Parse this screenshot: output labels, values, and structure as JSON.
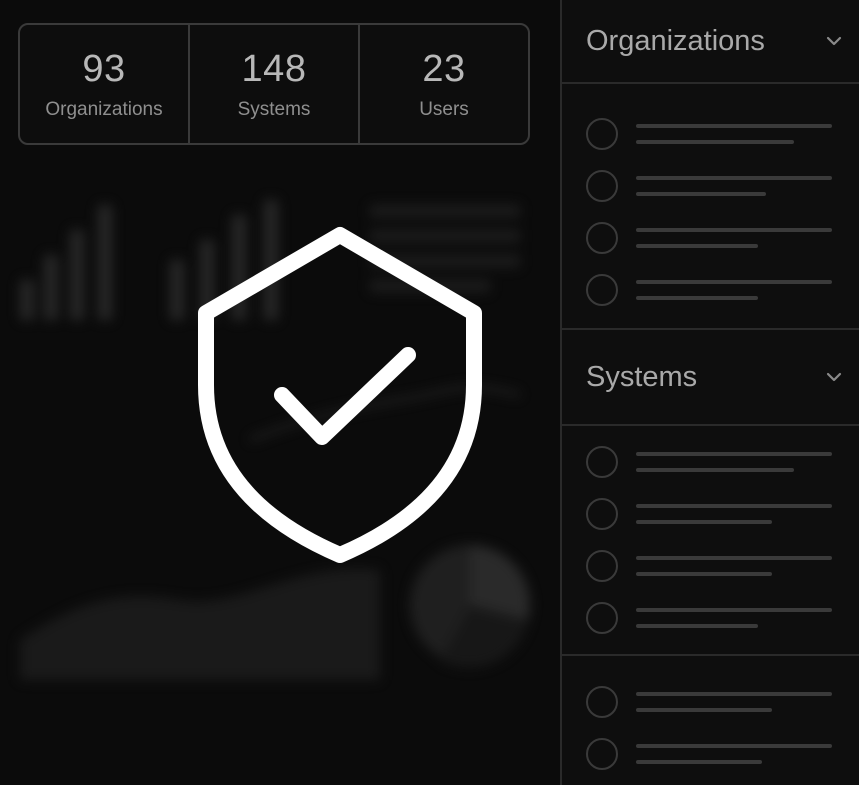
{
  "stats": [
    {
      "value": "93",
      "label": "Organizations"
    },
    {
      "value": "148",
      "label": "Systems"
    },
    {
      "value": "23",
      "label": "Users"
    }
  ],
  "sidebar": {
    "sections": [
      {
        "title": "Organizations",
        "icon": "chevron-down-icon",
        "row_count": 4
      },
      {
        "title": "Systems",
        "icon": "chevron-down-icon",
        "row_count": 4
      },
      {
        "title": "",
        "row_count": 2
      }
    ]
  },
  "overlay": {
    "icon": "shield-check-icon"
  },
  "colors": {
    "background": "#0a0a0a",
    "panel": "#0e0e0e",
    "border": "#3a3a3a",
    "text": "#b8b8b8",
    "icon": "#ffffff"
  }
}
